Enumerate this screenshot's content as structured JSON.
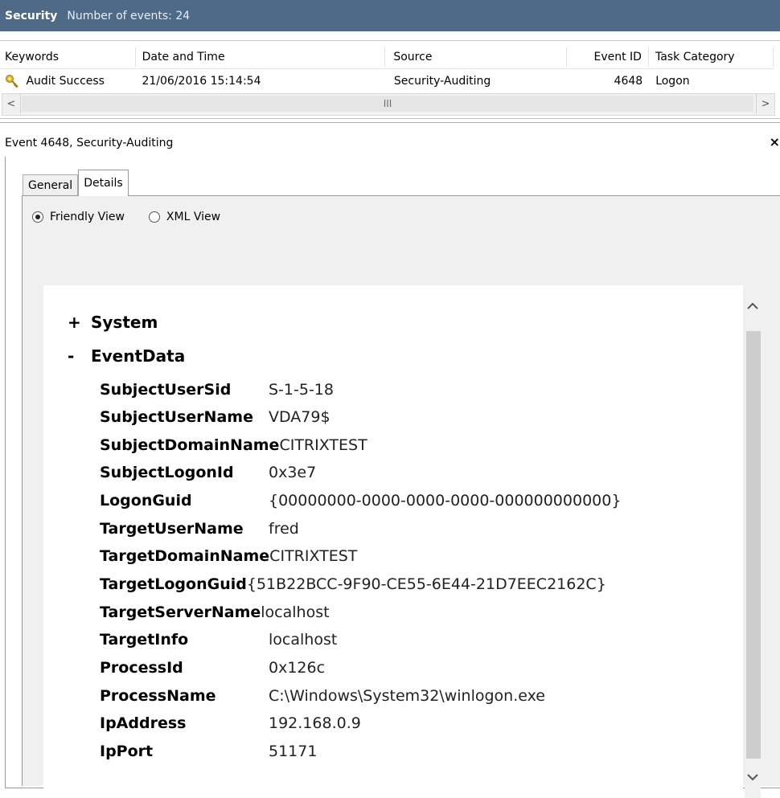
{
  "title_bar": {
    "log_name": "Security",
    "events_label": "Number of events: 24"
  },
  "event_list": {
    "columns": [
      "Keywords",
      "Date and Time",
      "Source",
      "Event ID",
      "Task Category"
    ],
    "rows": [
      {
        "keywords": "Audit Success",
        "datetime": "21/06/2016 15:14:54",
        "source": "Security-Auditing",
        "event_id": "4648",
        "task_category": "Logon"
      }
    ],
    "scroll": {
      "left": "<",
      "right": ">",
      "thumb_grip": "III"
    }
  },
  "event_header": {
    "title": "Event 4648, Security-Auditing",
    "close": "×"
  },
  "tabs": [
    {
      "label": "General"
    },
    {
      "label": "Details"
    }
  ],
  "view_options": [
    {
      "label": "Friendly View",
      "selected": true
    },
    {
      "label": "XML View",
      "selected": false
    }
  ],
  "details": {
    "system": {
      "symbol": "+",
      "label": "System"
    },
    "event_data": {
      "symbol": "-",
      "label": "EventData"
    },
    "fields": [
      {
        "key": "SubjectUserSid",
        "value": "S-1-5-18"
      },
      {
        "key": "SubjectUserName",
        "value": "VDA79$"
      },
      {
        "key": "SubjectDomainName",
        "value": "CITRIXTEST"
      },
      {
        "key": "SubjectLogonId",
        "value": "0x3e7"
      },
      {
        "key": "LogonGuid",
        "value": "{00000000-0000-0000-0000-000000000000}"
      },
      {
        "key": "TargetUserName",
        "value": "fred"
      },
      {
        "key": "TargetDomainName",
        "value": "CITRIXTEST"
      },
      {
        "key": "TargetLogonGuid",
        "value": "{51B22BCC-9F90-CE55-6E44-21D7EEC2162C}"
      },
      {
        "key": "TargetServerName",
        "value": "localhost"
      },
      {
        "key": "TargetInfo",
        "value": "localhost"
      },
      {
        "key": "ProcessId",
        "value": "0x126c"
      },
      {
        "key": "ProcessName",
        "value": "C:\\Windows\\System32\\winlogon.exe"
      },
      {
        "key": "IpAddress",
        "value": "192.168.0.9"
      },
      {
        "key": "IpPort",
        "value": "51171"
      }
    ]
  },
  "colors": {
    "title_bar": "#4f6a87",
    "panel_bg": "#f0f0f0"
  }
}
